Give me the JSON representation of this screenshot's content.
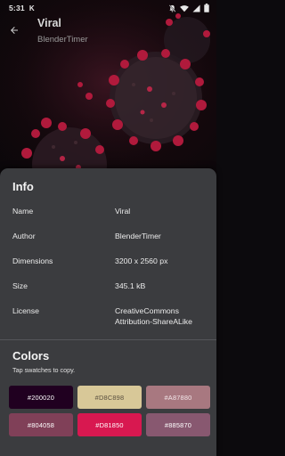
{
  "status_bar": {
    "time": "5:31",
    "notification_glyph": "K",
    "icons": [
      "notifications-off-icon",
      "wifi-icon",
      "cellular-signal-icon",
      "battery-icon"
    ]
  },
  "app_bar": {
    "title": "Viral",
    "subtitle": "BlenderTimer",
    "back_icon": "arrow-back-icon"
  },
  "info": {
    "heading": "Info",
    "rows": [
      {
        "label": "Name",
        "value": "Viral"
      },
      {
        "label": "Author",
        "value": "BlenderTimer"
      },
      {
        "label": "Dimensions",
        "value": "3200 x 2560 px"
      },
      {
        "label": "Size",
        "value": "345.1 kB"
      },
      {
        "label": "License",
        "value": "CreativeCommons Attribution-ShareALike"
      }
    ]
  },
  "colors": {
    "heading": "Colors",
    "hint": "Tap swatches to copy.",
    "swatches": [
      {
        "hex": "#200020",
        "text_color": "#ffffff"
      },
      {
        "hex": "#D8C898",
        "text_color": "#5a5040"
      },
      {
        "hex": "#A87880",
        "text_color": "#f2e6e8"
      },
      {
        "hex": "#804058",
        "text_color": "#ffffff"
      },
      {
        "hex": "#D81850",
        "text_color": "#ffffff"
      },
      {
        "hex": "#885870",
        "text_color": "#ffffff"
      }
    ]
  },
  "theme": {
    "sheet_background": "#3b3c3f",
    "virus_red": "#a01c36"
  }
}
